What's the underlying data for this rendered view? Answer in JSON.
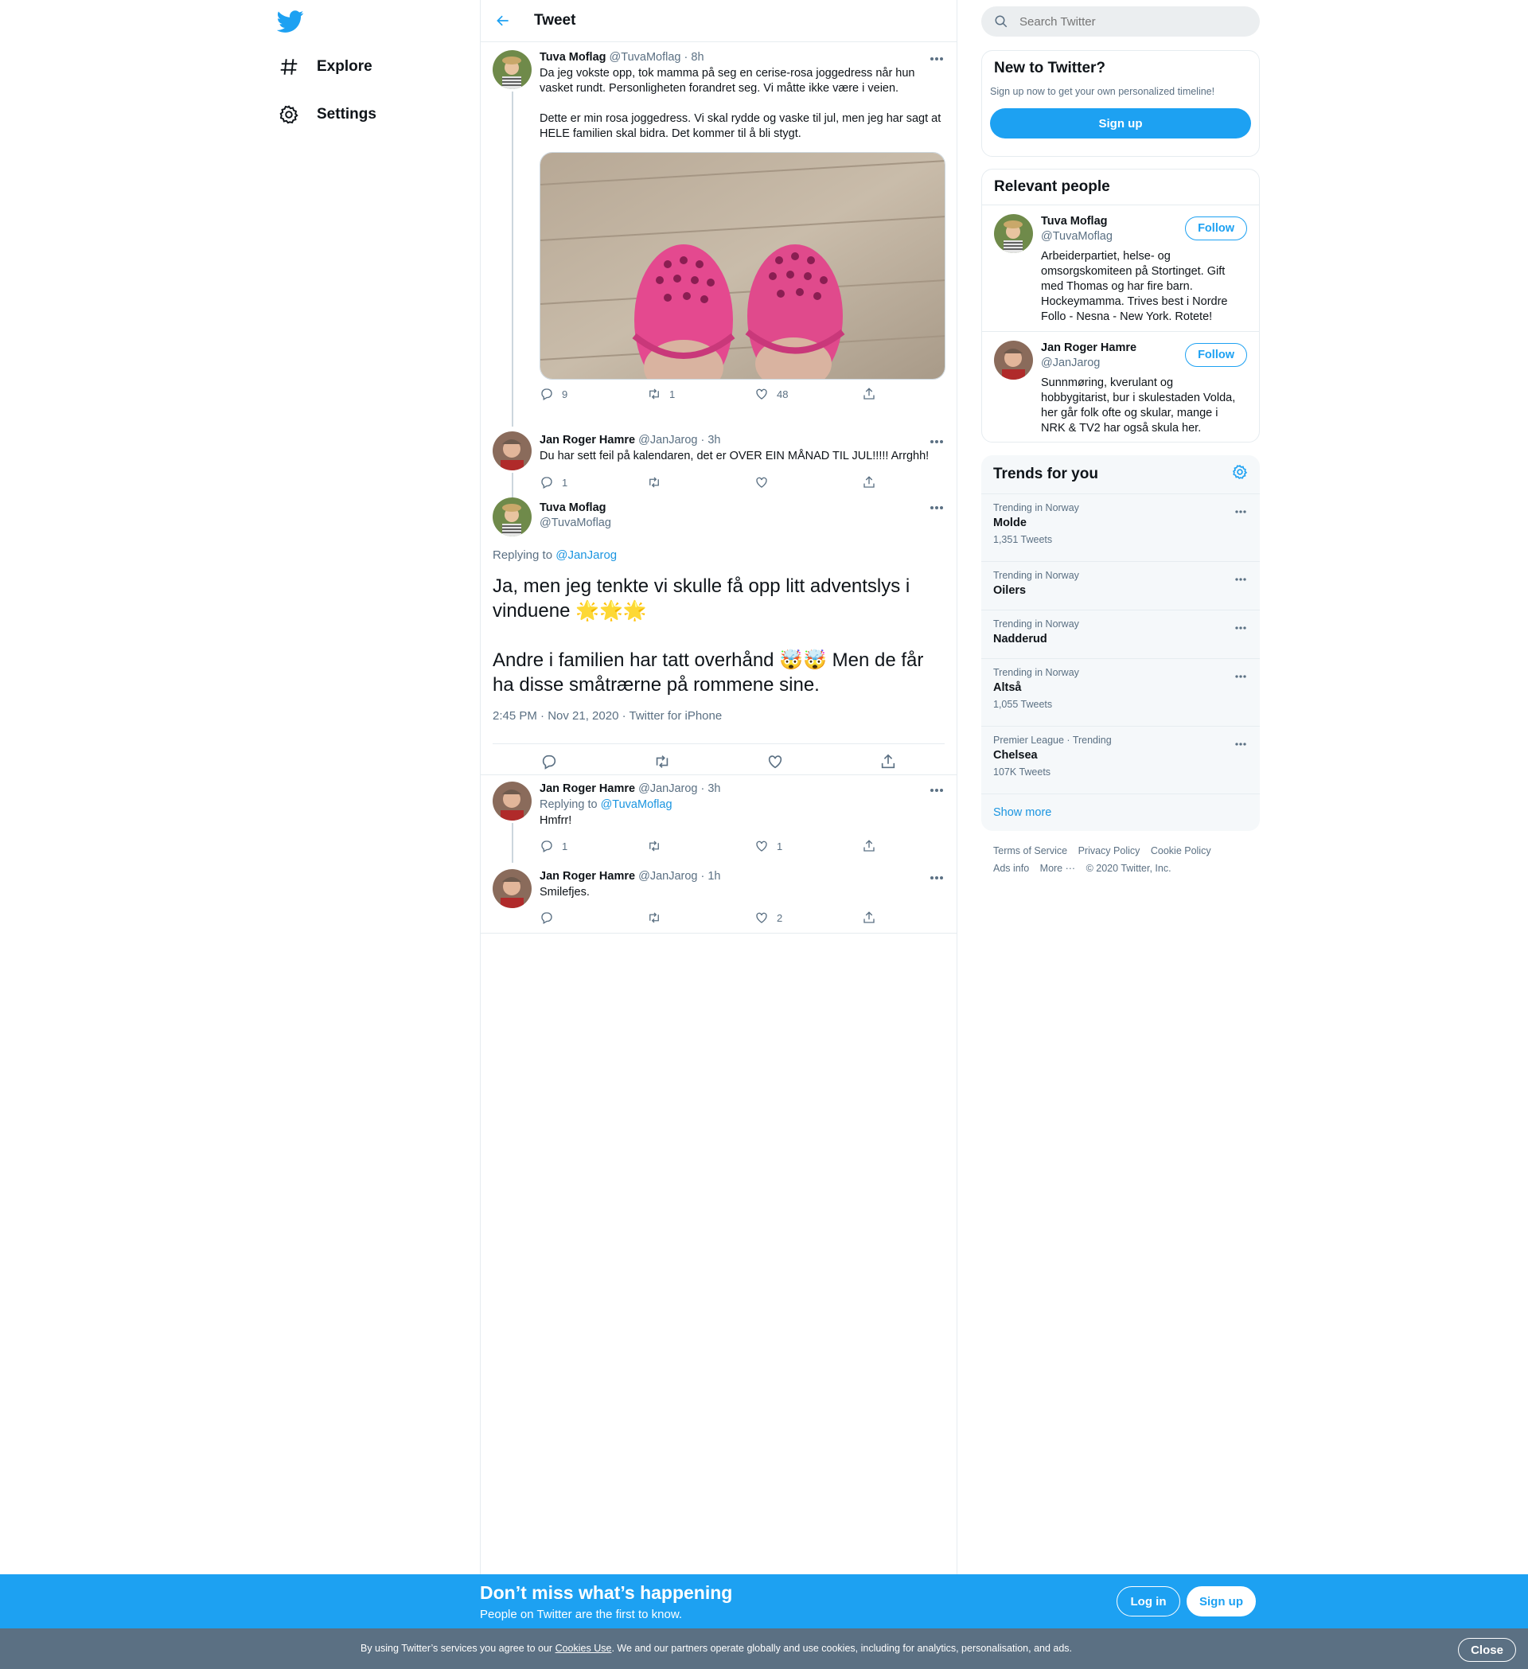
{
  "nav": {
    "explore_label": "Explore",
    "settings_label": "Settings"
  },
  "header": {
    "title": "Tweet"
  },
  "thread": {
    "tweet1": {
      "name": "Tuva Moflag",
      "handle": "@TuvaMoflag",
      "time": "· 8h",
      "text1": "Da jeg vokste opp, tok mamma på seg en cerise-rosa joggedress når hun vasket rundt. Personligheten forandret seg. Vi måtte ikke være i veien.",
      "text2": "Dette er min rosa joggedress. Vi skal rydde og vaske til jul, men jeg har sagt at HELE familien skal bidra. Det kommer til å bli stygt.",
      "replies": "9",
      "retweets": "1",
      "likes": "48"
    },
    "tweet2": {
      "name": "Jan Roger Hamre",
      "handle": "@JanJarog",
      "time": "· 3h",
      "text": "Du har sett feil på kalendaren, det er OVER EIN MÅNAD TIL JUL!!!!! Arrghh!",
      "replies": "1",
      "retweets": "",
      "likes": ""
    },
    "focus": {
      "name": "Tuva Moflag",
      "handle": "@TuvaMoflag",
      "replying_prefix": "Replying to",
      "replying_to": "@JanJarog",
      "text1": "Ja, men jeg tenkte vi skulle få opp litt adventslys i vinduene 🌟🌟🌟",
      "text2": "Andre i familien har tatt overhånd 🤯🤯 Men de får ha disse småtrærne på rommene sine.",
      "meta": "2:45 PM · Nov 21, 2020 · Twitter for iPhone"
    },
    "reply1": {
      "name": "Jan Roger Hamre",
      "handle": "@JanJarog",
      "time": "· 3h",
      "replying_prefix": "Replying to",
      "replying_to": "@TuvaMoflag",
      "text": "Hmfrr!",
      "replies": "1",
      "retweets": "",
      "likes": "1"
    },
    "reply2": {
      "name": "Jan Roger Hamre",
      "handle": "@JanJarog",
      "time": "· 1h",
      "text": "Smilefjes.",
      "replies": "",
      "retweets": "",
      "likes": "2"
    }
  },
  "search": {
    "placeholder": "Search Twitter"
  },
  "signup_card": {
    "title": "New to Twitter?",
    "subtitle": "Sign up now to get your own personalized timeline!",
    "button": "Sign up"
  },
  "relevant": {
    "title": "Relevant people",
    "people": [
      {
        "name": "Tuva Moflag",
        "handle": "@TuvaMoflag",
        "bio": "Arbeiderpartiet, helse- og omsorgskomiteen på Stortinget. Gift med Thomas og har fire barn. Hockeymamma. Trives best i Nordre Follo - Nesna - New York. Rotete!",
        "button": "Follow"
      },
      {
        "name": "Jan Roger Hamre",
        "handle": "@JanJarog",
        "bio": "Sunnmøring, kverulant og hobbygitarist, bur i skulestaden Volda, her går folk ofte og skular, mange i NRK & TV2 har også skula her.",
        "button": "Follow"
      }
    ]
  },
  "trends": {
    "title": "Trends for you",
    "items": [
      {
        "context": "Trending in Norway",
        "name": "Molde",
        "count": "1,351 Tweets"
      },
      {
        "context": "Trending in Norway",
        "name": "Oilers",
        "count": ""
      },
      {
        "context": "Trending in Norway",
        "name": "Nadderud",
        "count": ""
      },
      {
        "context": "Trending in Norway",
        "name": "Altså",
        "count": "1,055 Tweets"
      },
      {
        "context": "Premier League · Trending",
        "name": "Chelsea",
        "count": "107K Tweets"
      }
    ],
    "show_more": "Show more"
  },
  "footer": {
    "terms": "Terms of Service",
    "privacy": "Privacy Policy",
    "cookie": "Cookie Policy",
    "ads": "Ads info",
    "more": "More ···",
    "copyright": "© 2020 Twitter, Inc."
  },
  "bottom_bar": {
    "headline": "Don’t miss what’s happening",
    "subline": "People on Twitter are the first to know.",
    "login": "Log in",
    "signup": "Sign up"
  },
  "cookie_bar": {
    "text_before": "By using Twitter’s services you agree to our ",
    "link": "Cookies Use",
    "text_after": ". We and our partners operate globally and use cookies, including for analytics, personalisation, and ads.",
    "close": "Close"
  },
  "colors": {
    "accent": "#1da1f2",
    "link": "#1b95e0",
    "muted": "#5b7083",
    "cookie_bg": "#5b7083"
  }
}
